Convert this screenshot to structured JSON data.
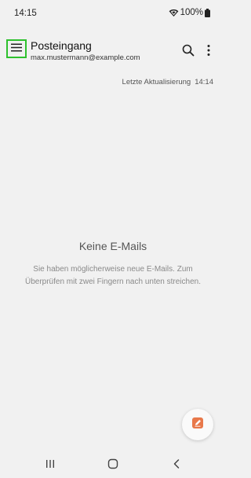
{
  "status_bar": {
    "time": "14:15",
    "battery_percent": "100%"
  },
  "app_bar": {
    "title": "Posteingang",
    "account_email": "max.mustermann@example.com"
  },
  "last_update": {
    "label": "Letzte Aktualisierung",
    "time": "14:14"
  },
  "empty_state": {
    "title": "Keine E-Mails",
    "description": "Sie haben möglicherweise neue E-Mails. Zum Überprüfen mit zwei Fingern nach unten streichen."
  },
  "colors": {
    "background": "#f1f1f1",
    "highlight": "#2ec12e",
    "fab_icon": "#e8784a"
  },
  "icons": {
    "menu": "menu-icon",
    "search": "search-icon",
    "more": "more-vert-icon",
    "compose": "compose-icon",
    "recents": "recents-icon",
    "home": "home-icon",
    "back": "back-icon"
  }
}
